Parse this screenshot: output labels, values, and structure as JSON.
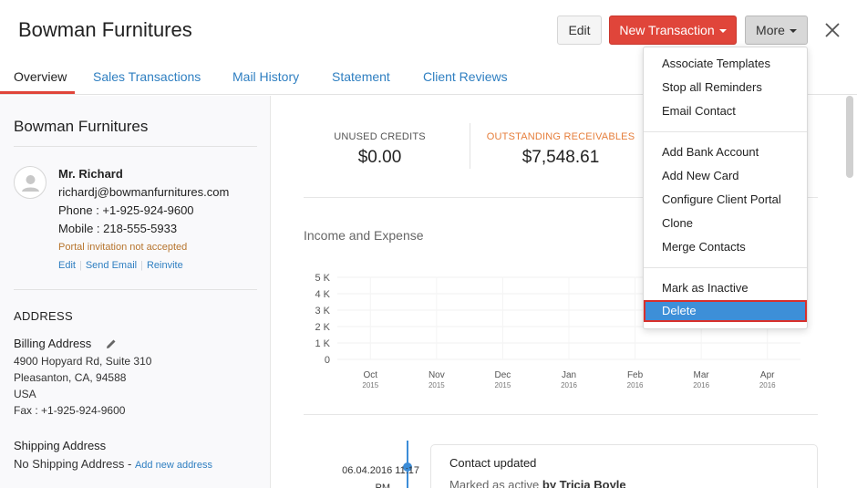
{
  "header": {
    "title": "Bowman Furnitures",
    "edit_label": "Edit",
    "new_transaction_label": "New Transaction",
    "more_label": "More"
  },
  "tabs": [
    {
      "label": "Overview"
    },
    {
      "label": "Sales Transactions"
    },
    {
      "label": "Mail History"
    },
    {
      "label": "Statement"
    },
    {
      "label": "Client Reviews"
    }
  ],
  "contact": {
    "company": "Bowman Furnitures",
    "name": "Mr. Richard",
    "email": "richardj@bowmanfurnitures.com",
    "phone": "Phone : +1-925-924-9600",
    "mobile": "Mobile : 218-555-5933",
    "portal_status": "Portal invitation not accepted",
    "links": {
      "edit": "Edit",
      "send_email": "Send Email",
      "reinvite": "Reinvite"
    }
  },
  "address": {
    "heading": "ADDRESS",
    "billing_label": "Billing Address",
    "billing_lines": [
      "4900 Hopyard Rd, Suite 310",
      "Pleasanton, CA, 94588",
      "USA",
      "Fax : +1-925-924-9600"
    ],
    "shipping_label": "Shipping Address",
    "shipping_none": "No Shipping Address - ",
    "add_new_address": "Add new address"
  },
  "summary": {
    "unused_credits_label": "UNUSED CREDITS",
    "unused_credits_value": "$0.00",
    "outstanding_label": "OUTSTANDING RECEIVABLES",
    "outstanding_value": "$7,548.61"
  },
  "colors": {
    "accent_red": "#e0453a",
    "link_blue": "#2f7fc1",
    "selected_blue": "#3d8fd8",
    "outstanding_orange": "#e67e3b"
  },
  "income_expense": {
    "title": "Income and Expense"
  },
  "chart_data": {
    "type": "bar",
    "categories": [
      "Oct",
      "Nov",
      "Dec",
      "Jan",
      "Feb",
      "Mar",
      "Apr"
    ],
    "category_years": [
      "2015",
      "2015",
      "2015",
      "2016",
      "2016",
      "2016",
      "2016"
    ],
    "y_ticks": [
      "0",
      "1 K",
      "2 K",
      "3 K",
      "4 K",
      "5 K"
    ],
    "ylim": [
      0,
      5000
    ],
    "grid": true,
    "series": [
      {
        "values": [
          0,
          0,
          0,
          0,
          0,
          0,
          0
        ]
      }
    ]
  },
  "timeline": [
    {
      "date_line1": "06.04.2016 11:17",
      "date_line2": "PM",
      "title": "Contact updated",
      "text": "Marked as active ",
      "by": "by Tricia Boyle"
    }
  ],
  "more_menu": {
    "groups": [
      [
        "Associate Templates",
        "Stop all Reminders",
        "Email Contact"
      ],
      [
        "Add Bank Account",
        "Add New Card",
        "Configure Client Portal",
        "Clone",
        "Merge Contacts"
      ],
      [
        "Mark as Inactive",
        "Delete"
      ]
    ],
    "selected": "Delete"
  }
}
